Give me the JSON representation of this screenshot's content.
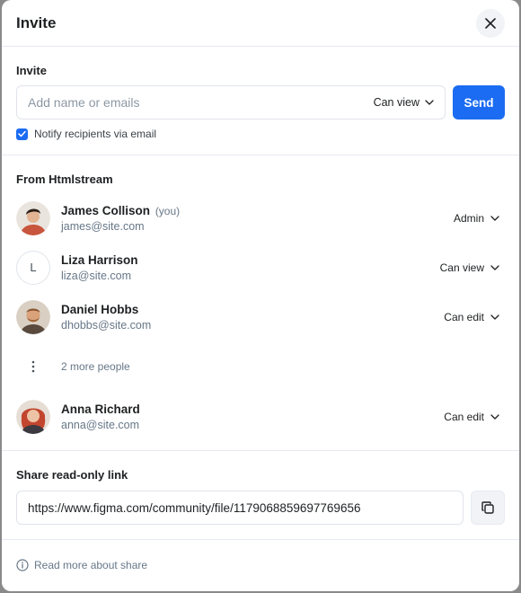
{
  "dialog": {
    "title": "Invite",
    "close_icon": "close-icon"
  },
  "invite": {
    "label": "Invite",
    "input_placeholder": "Add name or emails",
    "permission": "Can view",
    "send_label": "Send",
    "notify_checked": true,
    "notify_label": "Notify recipients via email"
  },
  "members": {
    "heading": "From Htmlstream",
    "list": [
      {
        "name": "James Collison",
        "you": "(you)",
        "email": "james@site.com",
        "role": "Admin",
        "avatar": "photo",
        "avatar_color": "#c8553d"
      },
      {
        "name": "Liza Harrison",
        "you": "",
        "email": "liza@site.com",
        "role": "Can view",
        "avatar": "initial",
        "initial": "L"
      },
      {
        "name": "Daniel Hobbs",
        "you": "",
        "email": "dhobbs@site.com",
        "role": "Can edit",
        "avatar": "photo",
        "avatar_color": "#a0663a"
      }
    ],
    "more_label": "2 more people",
    "last": {
      "name": "Anna Richard",
      "email": "anna@site.com",
      "role": "Can edit",
      "avatar": "photo",
      "avatar_color": "#c2452d"
    }
  },
  "share": {
    "label": "Share read-only link",
    "url": "https://www.figma.com/community/file/1179068859697769656",
    "copy_icon": "copy-icon"
  },
  "footer": {
    "text": "Read more about share",
    "info_icon": "info-icon"
  },
  "colors": {
    "accent": "#1b6cf2",
    "muted": "#677788",
    "border": "#e7eaf3"
  }
}
